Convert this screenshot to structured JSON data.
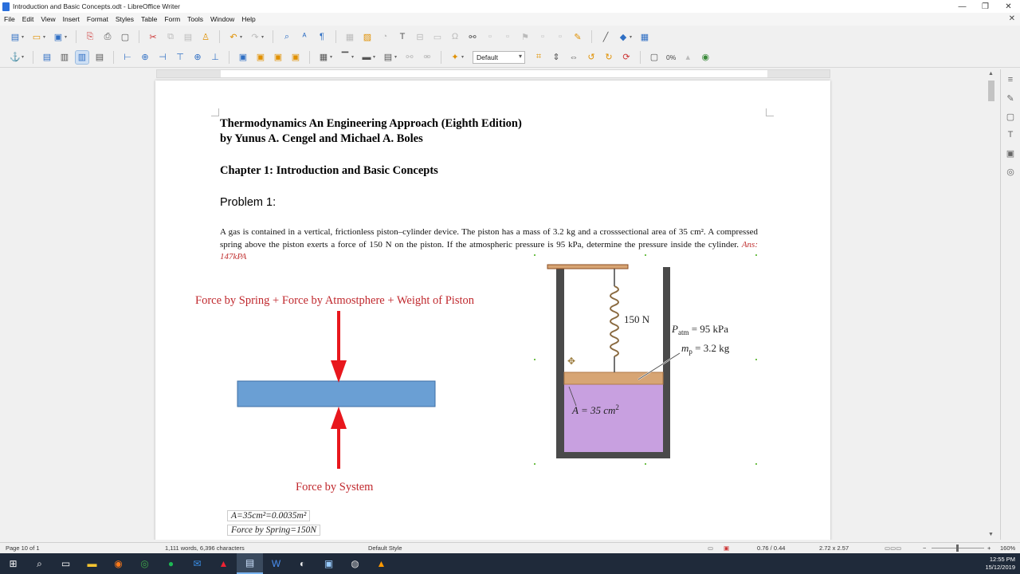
{
  "window": {
    "title": "Introduction and Basic Concepts.odt - LibreOffice Writer"
  },
  "menu": [
    "File",
    "Edit",
    "View",
    "Insert",
    "Format",
    "Styles",
    "Table",
    "Form",
    "Tools",
    "Window",
    "Help"
  ],
  "toolbar": {
    "frame_style": "Default",
    "transparency": "0%"
  },
  "document": {
    "title_line1": "Thermodynamics An Engineering Approach (Eighth Edition)",
    "title_line2": "by Yunus A. Cengel and Michael A. Boles",
    "chapter": "Chapter 1: Introduction and Basic Concepts",
    "problem_heading": "Problem 1:",
    "problem_text": "A gas is contained in a vertical, frictionless piston–cylinder device. The piston has a mass of 3.2 kg and a crosssectional area of 35 cm². A compressed spring above the piston exerts a force of 150 N on the piston. If the atmospheric pressure is 95 kPa, determine the pressure inside the cylinder.",
    "answer": "Ans: 147kPA",
    "fbd_top_label": "Force by Spring + Force by Atmostphere + Weight of Piston",
    "fbd_bottom_label": "Force by System",
    "eq1": "A=35cm²=0.0035m²",
    "eq2": "Force by Spring=150N"
  },
  "diagram": {
    "spring_force": "150 N",
    "p_atm": "P",
    "p_atm_sub": "atm",
    "p_atm_value": " = 95 kPa",
    "m_p": "m",
    "m_p_sub": "p",
    "m_p_value": " = 3.2 kg",
    "area_label": "A = 35 cm",
    "area_sup": "2"
  },
  "status": {
    "page": "Page 10 of 1",
    "words": "1,111 words, 6,396 characters",
    "style": "Default Style",
    "position": "0.76 / 0.44",
    "size": "2.72 x 2.57",
    "zoom": "160%"
  },
  "taskbar": {
    "time": "12:55 PM",
    "date": "15/12/2019"
  },
  "colors": {
    "accent_red": "#c0282d",
    "piston_blue": "#6a9fd4",
    "gas_purple": "#c8a0e0",
    "piston_wood": "#d7a574"
  }
}
